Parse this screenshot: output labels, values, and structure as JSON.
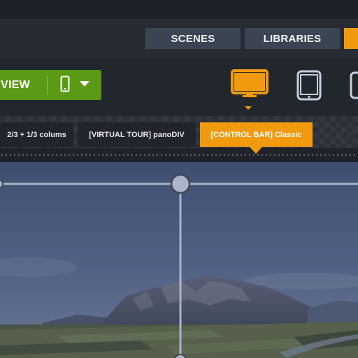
{
  "nav": {
    "tabs": [
      {
        "label": "SCENES"
      },
      {
        "label": "LIBRARIES"
      }
    ]
  },
  "toolbar": {
    "preview_label": "EVIEW",
    "devices": [
      "desktop-icon",
      "tablet-icon",
      "tablet-icon"
    ],
    "active_device": "desktop"
  },
  "layout_tabs": [
    {
      "label": "2/3 + 1/3 colums"
    },
    {
      "label": "[VIRTUAL TOUR] panoDIV"
    },
    {
      "label": "[CONTROL BAR] Classic"
    }
  ],
  "colors": {
    "accent": "#f19a0e",
    "preview_green": "#5a9a14",
    "tab_bg": "#3b4452",
    "guide": "#aab4c6"
  }
}
